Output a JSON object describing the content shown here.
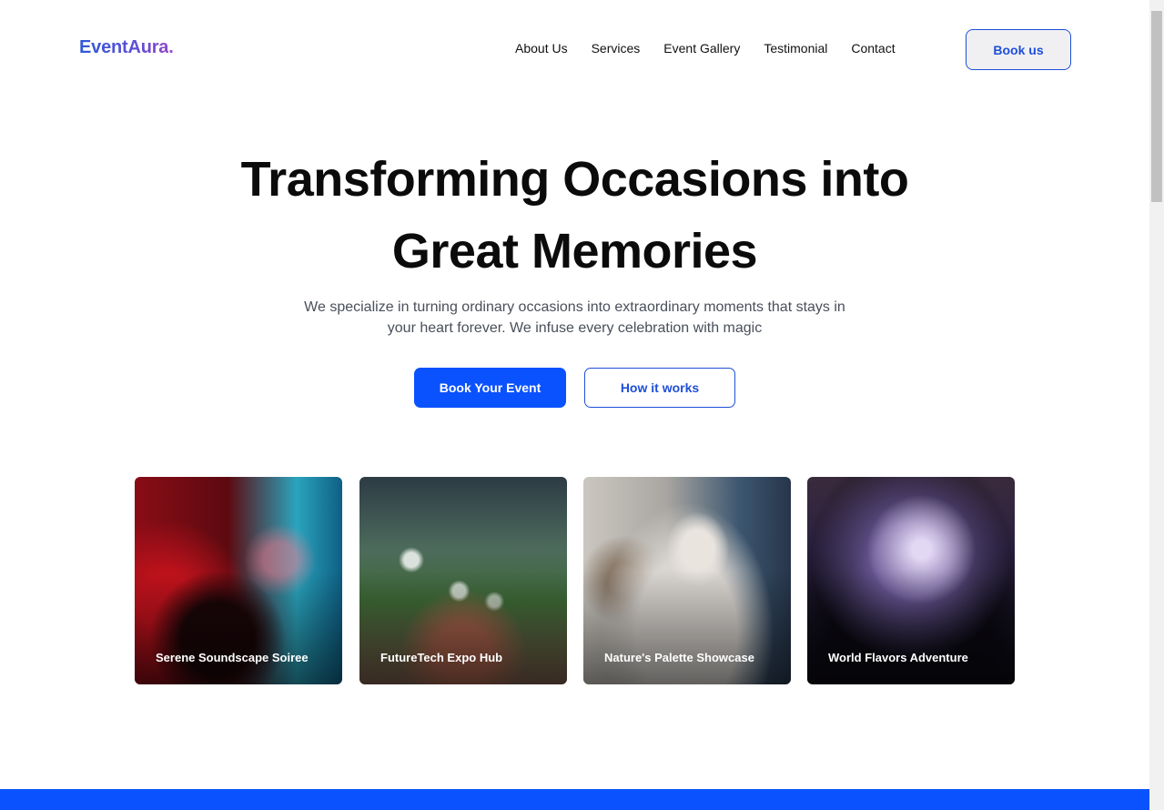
{
  "header": {
    "logo_name": "EventAura",
    "logo_dot": ".",
    "nav": [
      "About Us",
      "Services",
      "Event Gallery",
      "Testimonial",
      "Contact"
    ],
    "book_button": "Book us"
  },
  "hero": {
    "title_line1": "Transforming Occasions into",
    "title_line2": "Great Memories",
    "subtitle_line1": "We specialize in turning ordinary occasions into extraordinary moments that stays in",
    "subtitle_line2": "your heart forever. We infuse every celebration with magic",
    "primary_button": "Book Your Event",
    "secondary_button": "How it works"
  },
  "events": [
    {
      "title": "Serene Soundscape Soiree"
    },
    {
      "title": "FutureTech Expo Hub"
    },
    {
      "title": "Nature's Palette Showcase"
    },
    {
      "title": "World Flavors Adventure"
    }
  ],
  "colors": {
    "accent": "#0b52ff",
    "outline": "#1f4fd8",
    "logo_gradient_start": "#2f5bd8",
    "logo_gradient_end": "#8a48c8"
  }
}
